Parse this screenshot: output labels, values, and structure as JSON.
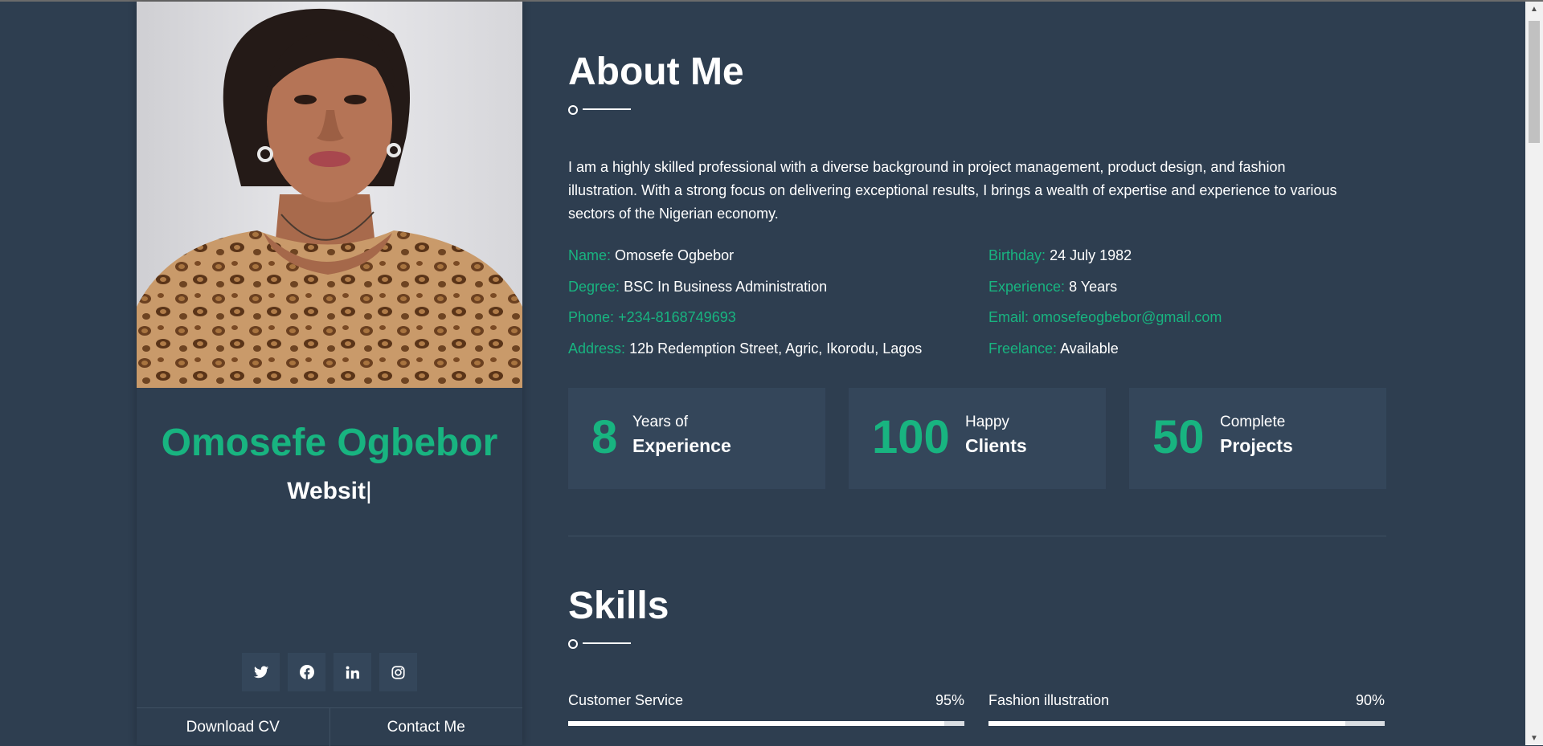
{
  "profile": {
    "name": "Omosefe Ogbebor",
    "typed_text": "Websit",
    "cursor": "|",
    "socials": [
      {
        "icon": "twitter-icon"
      },
      {
        "icon": "facebook-icon"
      },
      {
        "icon": "linkedin-icon"
      },
      {
        "icon": "instagram-icon"
      }
    ],
    "download_cv": "Download CV",
    "contact_me": "Contact Me"
  },
  "about": {
    "title": "About Me",
    "bio": "I am a highly skilled professional with a diverse background in project management, product design, and fashion illustration. With a strong focus on delivering exceptional results, I brings a wealth of expertise and experience to various sectors of the Nigerian economy.",
    "info": {
      "name_label": "Name:",
      "name_value": "Omosefe Ogbebor",
      "degree_label": "Degree:",
      "degree_value": "BSC In Business Administration",
      "phone_label": "Phone:",
      "phone_value": "+234-8168749693",
      "address_label": "Address:",
      "address_value": "12b Redemption Street, Agric, Ikorodu, Lagos",
      "birthday_label": "Birthday:",
      "birthday_value": "24 July 1982",
      "experience_label": "Experience:",
      "experience_value": "8 Years",
      "email_label": "Email:",
      "email_value": "omosefeogbebor@gmail.com",
      "freelance_label": "Freelance:",
      "freelance_value": "Available"
    },
    "stats": [
      {
        "number": "8",
        "top": "Years of",
        "bottom": "Experience"
      },
      {
        "number": "100",
        "top": "Happy",
        "bottom": "Clients"
      },
      {
        "number": "50",
        "top": "Complete",
        "bottom": "Projects"
      }
    ]
  },
  "skills": {
    "title": "Skills",
    "items": [
      {
        "name": "Customer Service",
        "percent_label": "95%",
        "percent": 95
      },
      {
        "name": "Fashion illustration",
        "percent_label": "90%",
        "percent": 90
      }
    ]
  },
  "colors": {
    "accent": "#18b480",
    "background": "#2e3e50",
    "card": "#34465a"
  }
}
